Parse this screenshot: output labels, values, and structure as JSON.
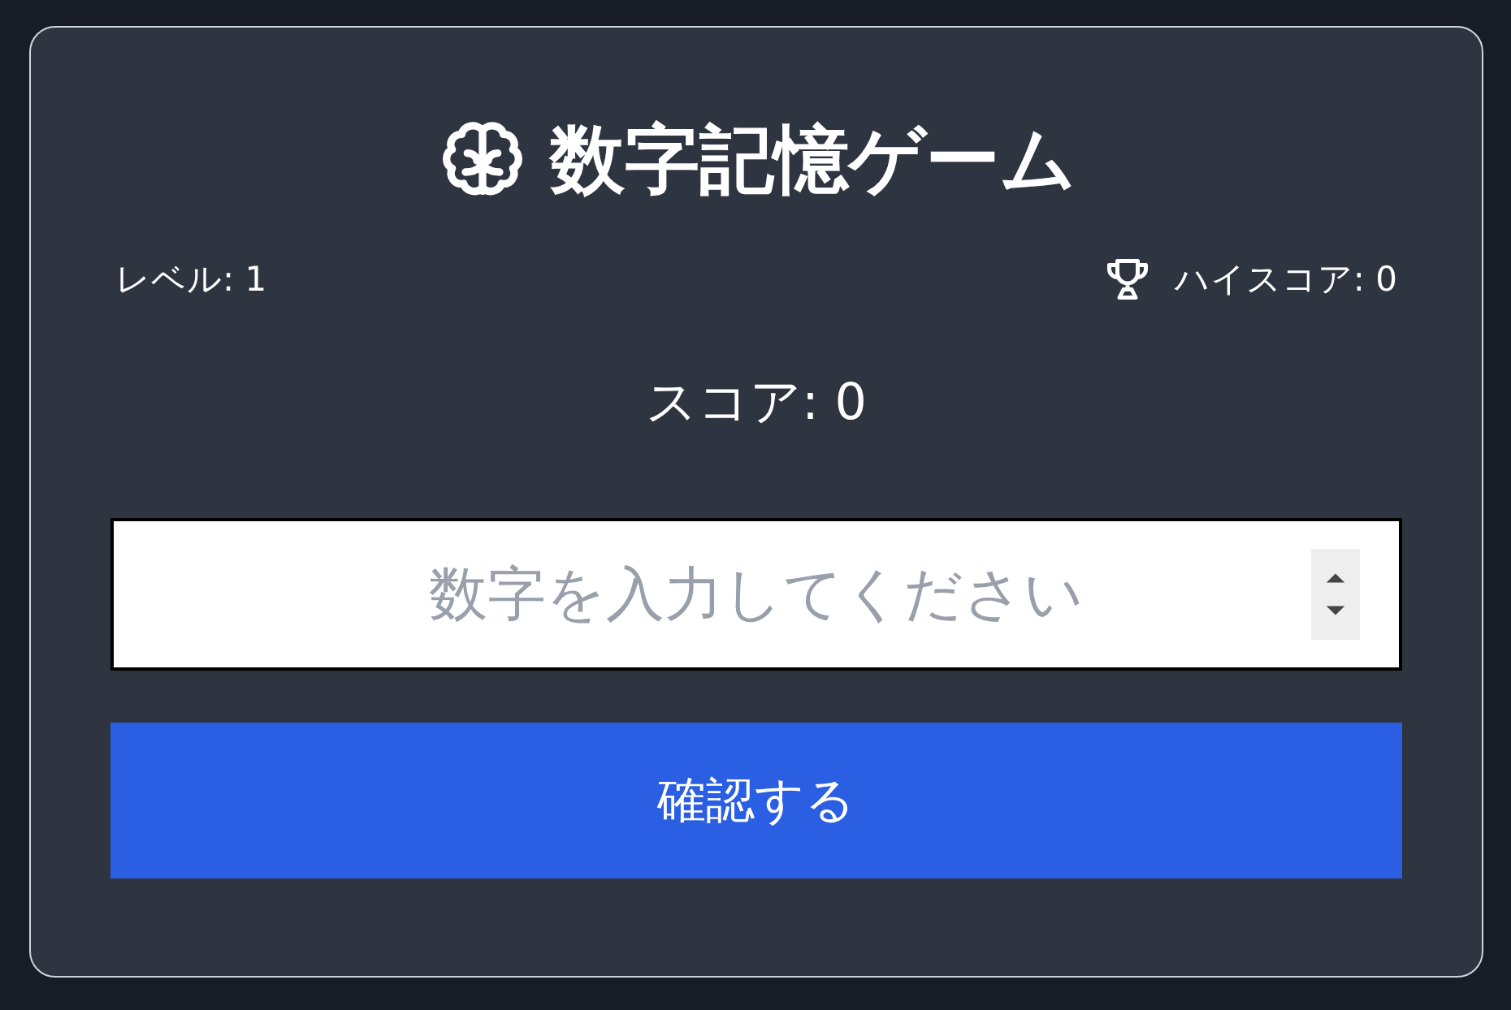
{
  "title": "数字記憶ゲーム",
  "level": "レベル: 1",
  "high_score": "ハイスコア: 0",
  "score": "スコア: 0",
  "input": {
    "placeholder": "数字を入力してください"
  },
  "submit_button": "確認する"
}
